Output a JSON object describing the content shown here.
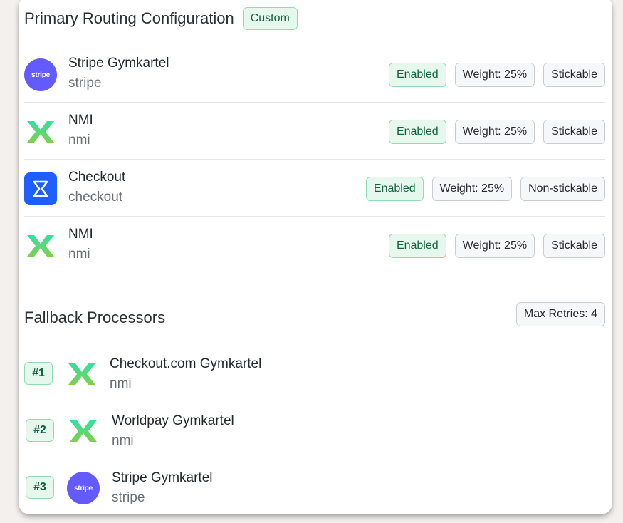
{
  "primary": {
    "title": "Primary Routing Configuration",
    "badge": "Custom",
    "processors": [
      {
        "name": "Stripe Gymkartel",
        "type": "stripe",
        "logo": "stripe-logo",
        "status": "Enabled",
        "weight": "Weight: 25%",
        "sticky": "Stickable"
      },
      {
        "name": "NMI",
        "type": "nmi",
        "logo": "nmi-logo",
        "status": "Enabled",
        "weight": "Weight: 25%",
        "sticky": "Stickable"
      },
      {
        "name": "Checkout",
        "type": "checkout",
        "logo": "checkout-logo",
        "status": "Enabled",
        "weight": "Weight: 25%",
        "sticky": "Non-stickable"
      },
      {
        "name": "NMI",
        "type": "nmi",
        "logo": "nmi-logo",
        "status": "Enabled",
        "weight": "Weight: 25%",
        "sticky": "Stickable"
      }
    ]
  },
  "fallback": {
    "title": "Fallback Processors",
    "max_retries": "Max Retries: 4",
    "processors": [
      {
        "rank": "#1",
        "name": "Checkout.com Gymkartel",
        "type": "nmi",
        "logo": "nmi-logo"
      },
      {
        "rank": "#2",
        "name": "Worldpay Gymkartel",
        "type": "nmi",
        "logo": "nmi-logo"
      },
      {
        "rank": "#3",
        "name": "Stripe Gymkartel",
        "type": "stripe",
        "logo": "stripe-logo"
      }
    ]
  },
  "logos": {
    "stripe_text": "stripe"
  },
  "colors": {
    "stripe": "#635bff",
    "checkout": "#1f5eff",
    "enabled_bg": "#e6f7ee",
    "enabled_text": "#11633c"
  }
}
